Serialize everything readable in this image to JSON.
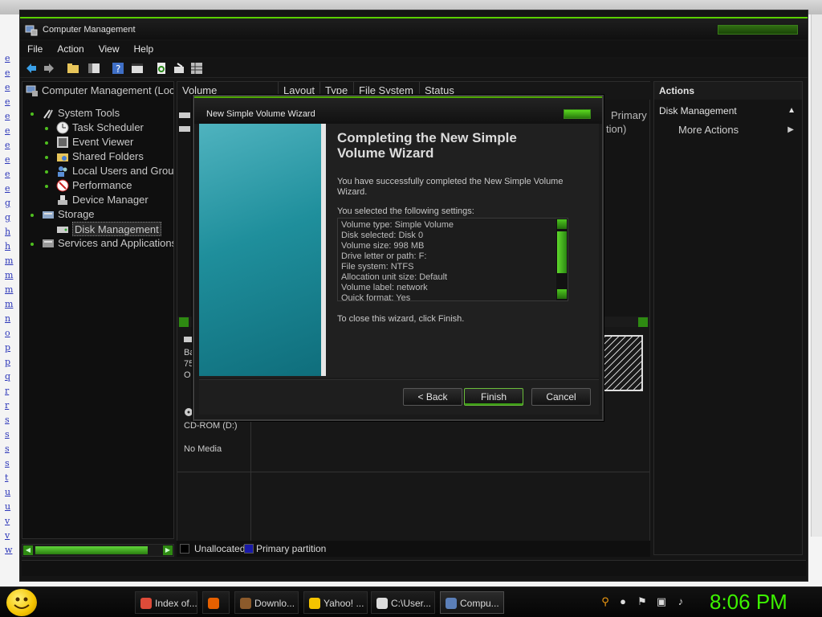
{
  "background": {
    "link_letters": [
      "e",
      "e",
      "e",
      "e",
      "e",
      "e",
      "e",
      "e",
      "e",
      "e",
      "g",
      "g",
      "h",
      "h",
      "m",
      "m",
      "m",
      "m",
      "n",
      "o",
      "p",
      "p",
      "q",
      "r",
      "r",
      "s",
      "s",
      "s",
      "s",
      "t",
      "u",
      "u",
      "v",
      "v",
      "w"
    ]
  },
  "window": {
    "title": "Computer Management",
    "menu": [
      "File",
      "Action",
      "View",
      "Help"
    ]
  },
  "tree": {
    "root": "Computer Management (Loc",
    "items": [
      {
        "label": "System Tools"
      },
      {
        "label": "Task Scheduler"
      },
      {
        "label": "Event Viewer"
      },
      {
        "label": "Shared Folders"
      },
      {
        "label": "Local Users and Grou"
      },
      {
        "label": "Performance"
      },
      {
        "label": "Device Manager"
      },
      {
        "label": "Storage"
      },
      {
        "label": "Disk Management"
      },
      {
        "label": "Services and Applications"
      }
    ]
  },
  "volume_list": {
    "columns": [
      "Volume",
      "Layout",
      "Type",
      "File System",
      "Status"
    ],
    "partial_text_1": "Primary",
    "partial_text_2": "tion)"
  },
  "disk_view": {
    "disk_frag_1": "Ba",
    "disk_frag_2": "75",
    "disk_frag_3": "O",
    "cdrom_label": "CD-ROM (D:)",
    "cdrom_status": "No Media"
  },
  "legend": {
    "unallocated": "Unallocated",
    "primary": "Primary partition"
  },
  "actions": {
    "header": "Actions",
    "section": "Disk Management",
    "more": "More Actions"
  },
  "dialog": {
    "title": "New Simple Volume Wizard",
    "heading_line1": "Completing the New Simple",
    "heading_line2": "Volume Wizard",
    "success_line1": "You have successfully completed the New Simple Volume",
    "success_line2": "Wizard.",
    "selected_label": "You selected the following settings:",
    "settings": [
      "Volume type: Simple Volume",
      "Disk selected: Disk 0",
      "Volume size: 998 MB",
      "Drive letter or path: F:",
      "File system: NTFS",
      "Allocation unit size: Default",
      "Volume label: network",
      "Quick format: Yes"
    ],
    "close_text": "To close this wizard, click Finish.",
    "back_label": "< Back",
    "finish_label": "Finish",
    "cancel_label": "Cancel"
  },
  "taskbar": {
    "buttons": [
      {
        "label": "Index of...",
        "color": "#dd4b39"
      },
      {
        "label": "",
        "color": "#e66000"
      },
      {
        "label": "Downlo...",
        "color": "#8b5a2b"
      },
      {
        "label": "Yahoo! ...",
        "color": "#f5c400"
      },
      {
        "label": "C:\\User...",
        "color": "#dddddd"
      },
      {
        "label": "Compu...",
        "color": "#5b7fb8"
      }
    ],
    "clock": "8:06 PM"
  },
  "colors": {
    "accent": "#4fbf1f",
    "clock": "#3cf200"
  }
}
